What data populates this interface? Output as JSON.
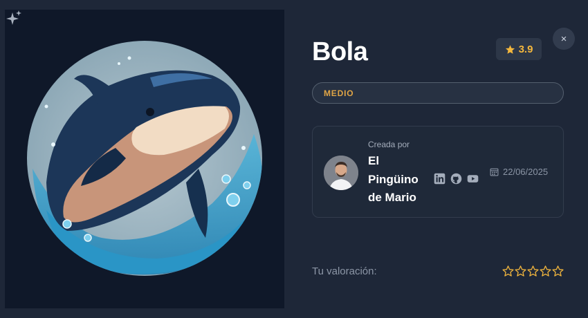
{
  "exercise": {
    "title": "Bola",
    "rating": "3.9",
    "difficulty": "MEDIO",
    "image_description_icon": "orca-illustration"
  },
  "author": {
    "created_by_label": "Creada por",
    "name": "El Pingüino de Mario",
    "socials": [
      "linkedin-icon",
      "github-icon",
      "youtube-icon"
    ],
    "date": "22/06/2025"
  },
  "user_rating": {
    "label": "Tu valoración:",
    "stars_filled": 0,
    "stars_total": 5
  },
  "colors": {
    "background": "#1e2738",
    "accent_gold": "#f5b83d",
    "difficulty": "#e0a546"
  },
  "close_icon": "×"
}
